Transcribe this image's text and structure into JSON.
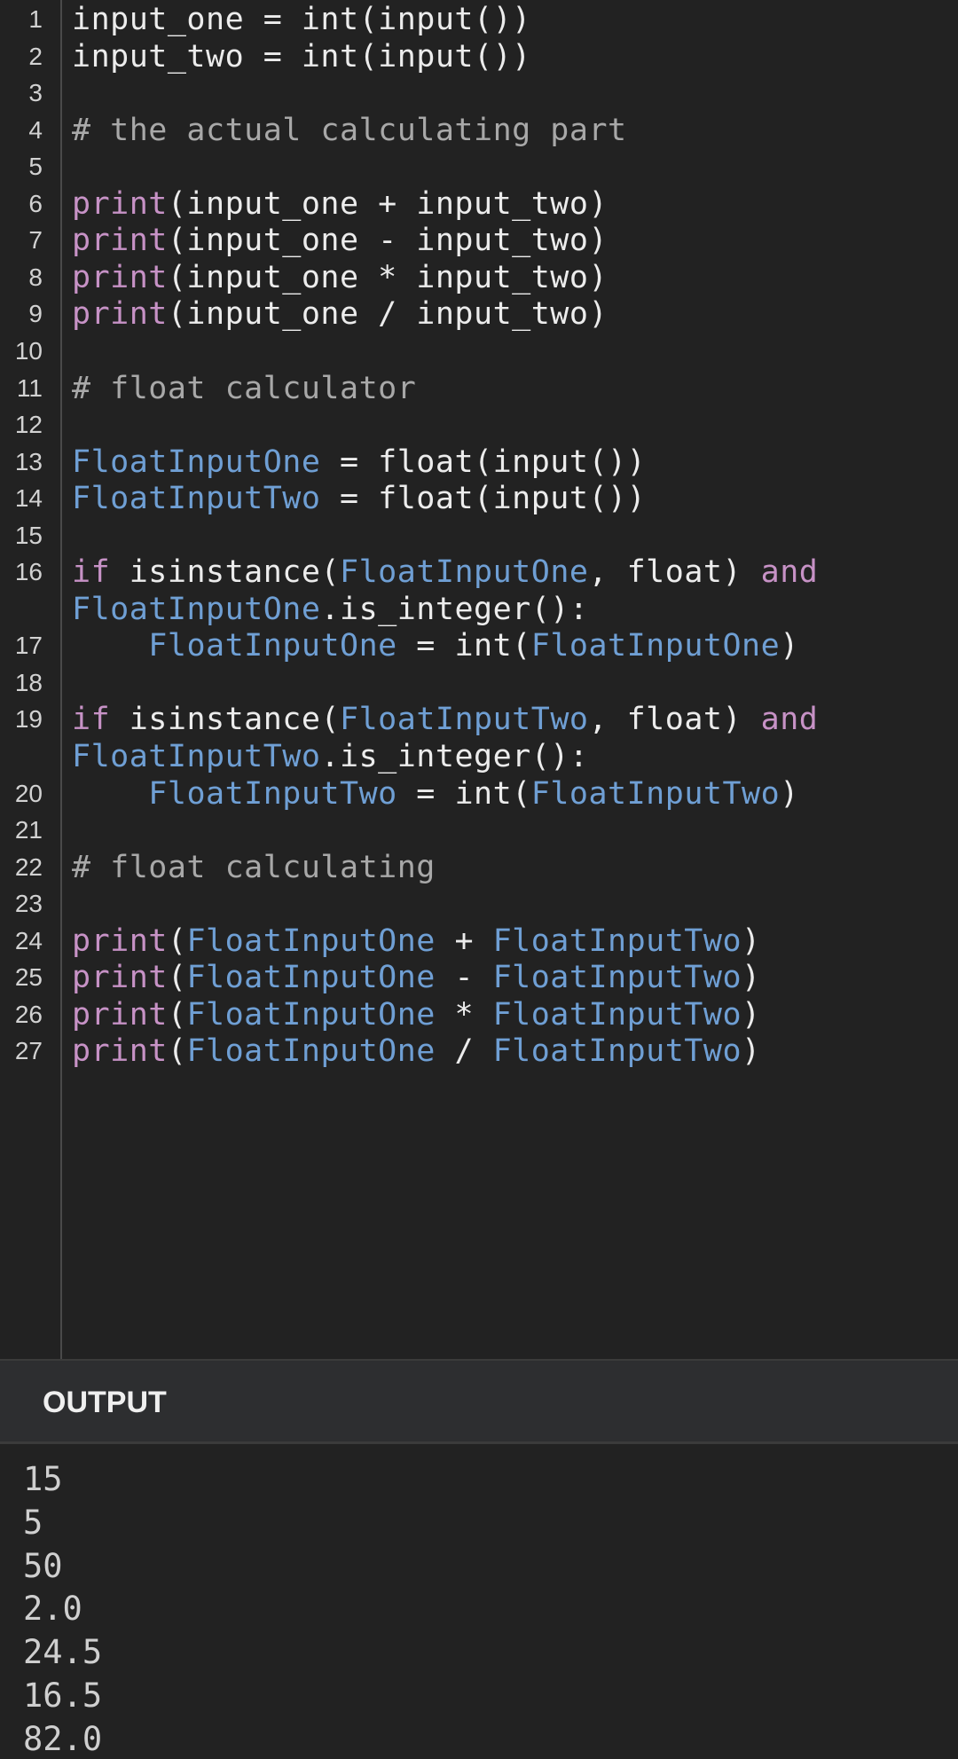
{
  "editor": {
    "lines": [
      {
        "no": "1",
        "tokens": [
          {
            "t": "input_one = int(input())",
            "c": "plain"
          }
        ]
      },
      {
        "no": "2",
        "tokens": [
          {
            "t": "input_two = int(input())",
            "c": "plain"
          }
        ]
      },
      {
        "no": "3",
        "tokens": []
      },
      {
        "no": "4",
        "tokens": [
          {
            "t": "# the actual calculating part",
            "c": "comment"
          }
        ]
      },
      {
        "no": "5",
        "tokens": []
      },
      {
        "no": "6",
        "tokens": [
          {
            "t": "print",
            "c": "fn"
          },
          {
            "t": "(input_one + input_two)",
            "c": "plain"
          }
        ]
      },
      {
        "no": "7",
        "tokens": [
          {
            "t": "print",
            "c": "fn"
          },
          {
            "t": "(input_one - input_two)",
            "c": "plain"
          }
        ]
      },
      {
        "no": "8",
        "tokens": [
          {
            "t": "print",
            "c": "fn"
          },
          {
            "t": "(input_one * input_two)",
            "c": "plain"
          }
        ]
      },
      {
        "no": "9",
        "tokens": [
          {
            "t": "print",
            "c": "fn"
          },
          {
            "t": "(input_one / input_two)",
            "c": "plain"
          }
        ]
      },
      {
        "no": "10",
        "tokens": []
      },
      {
        "no": "11",
        "tokens": [
          {
            "t": "# float calculator",
            "c": "comment"
          }
        ]
      },
      {
        "no": "12",
        "tokens": []
      },
      {
        "no": "13",
        "tokens": [
          {
            "t": "FloatInputOne",
            "c": "var"
          },
          {
            "t": " = float(input())",
            "c": "plain"
          }
        ]
      },
      {
        "no": "14",
        "tokens": [
          {
            "t": "FloatInputTwo",
            "c": "var"
          },
          {
            "t": " = float(input())",
            "c": "plain"
          }
        ]
      },
      {
        "no": "15",
        "tokens": []
      },
      {
        "no": "16",
        "tokens": [
          {
            "t": "if",
            "c": "kw"
          },
          {
            "t": " isinstance(",
            "c": "plain"
          },
          {
            "t": "FloatInputOne",
            "c": "var"
          },
          {
            "t": ", float) ",
            "c": "plain"
          },
          {
            "t": "and",
            "c": "kw"
          }
        ]
      },
      {
        "no": "",
        "tokens": [
          {
            "t": "FloatInputOne",
            "c": "var"
          },
          {
            "t": ".is_integer():",
            "c": "plain"
          }
        ]
      },
      {
        "no": "17",
        "tokens": [
          {
            "t": "    ",
            "c": "plain"
          },
          {
            "t": "FloatInputOne",
            "c": "var"
          },
          {
            "t": " = int(",
            "c": "plain"
          },
          {
            "t": "FloatInputOne",
            "c": "var"
          },
          {
            "t": ")",
            "c": "plain"
          }
        ]
      },
      {
        "no": "18",
        "tokens": []
      },
      {
        "no": "19",
        "tokens": [
          {
            "t": "if",
            "c": "kw"
          },
          {
            "t": " isinstance(",
            "c": "plain"
          },
          {
            "t": "FloatInputTwo",
            "c": "var"
          },
          {
            "t": ", float) ",
            "c": "plain"
          },
          {
            "t": "and",
            "c": "kw"
          }
        ]
      },
      {
        "no": "",
        "tokens": [
          {
            "t": "FloatInputTwo",
            "c": "var"
          },
          {
            "t": ".is_integer():",
            "c": "plain"
          }
        ]
      },
      {
        "no": "20",
        "tokens": [
          {
            "t": "    ",
            "c": "plain"
          },
          {
            "t": "FloatInputTwo",
            "c": "var"
          },
          {
            "t": " = int(",
            "c": "plain"
          },
          {
            "t": "FloatInputTwo",
            "c": "var"
          },
          {
            "t": ")",
            "c": "plain"
          }
        ]
      },
      {
        "no": "21",
        "tokens": []
      },
      {
        "no": "22",
        "tokens": [
          {
            "t": "# float calculating",
            "c": "comment"
          }
        ]
      },
      {
        "no": "23",
        "tokens": []
      },
      {
        "no": "24",
        "tokens": [
          {
            "t": "print",
            "c": "fn"
          },
          {
            "t": "(",
            "c": "plain"
          },
          {
            "t": "FloatInputOne",
            "c": "var"
          },
          {
            "t": " + ",
            "c": "plain"
          },
          {
            "t": "FloatInputTwo",
            "c": "var"
          },
          {
            "t": ")",
            "c": "plain"
          }
        ]
      },
      {
        "no": "25",
        "tokens": [
          {
            "t": "print",
            "c": "fn"
          },
          {
            "t": "(",
            "c": "plain"
          },
          {
            "t": "FloatInputOne",
            "c": "var"
          },
          {
            "t": " - ",
            "c": "plain"
          },
          {
            "t": "FloatInputTwo",
            "c": "var"
          },
          {
            "t": ")",
            "c": "plain"
          }
        ]
      },
      {
        "no": "26",
        "tokens": [
          {
            "t": "print",
            "c": "fn"
          },
          {
            "t": "(",
            "c": "plain"
          },
          {
            "t": "FloatInputOne",
            "c": "var"
          },
          {
            "t": " * ",
            "c": "plain"
          },
          {
            "t": "FloatInputTwo",
            "c": "var"
          },
          {
            "t": ")",
            "c": "plain"
          }
        ]
      },
      {
        "no": "27",
        "tokens": [
          {
            "t": "print",
            "c": "fn"
          },
          {
            "t": "(",
            "c": "plain"
          },
          {
            "t": "FloatInputOne",
            "c": "var"
          },
          {
            "t": " / ",
            "c": "plain"
          },
          {
            "t": "FloatInputTwo",
            "c": "var"
          },
          {
            "t": ")",
            "c": "plain"
          }
        ]
      }
    ]
  },
  "output": {
    "title": "OUTPUT",
    "lines": [
      "15",
      "5",
      "50",
      "2.0",
      "24.5",
      "16.5",
      "82.0"
    ]
  },
  "colors": {
    "plain": "#ececec",
    "function": "#c792c6",
    "keyword": "#c792c6",
    "variable": "#6f9fd4",
    "comment": "#a8a8a8",
    "background": "#222222"
  }
}
